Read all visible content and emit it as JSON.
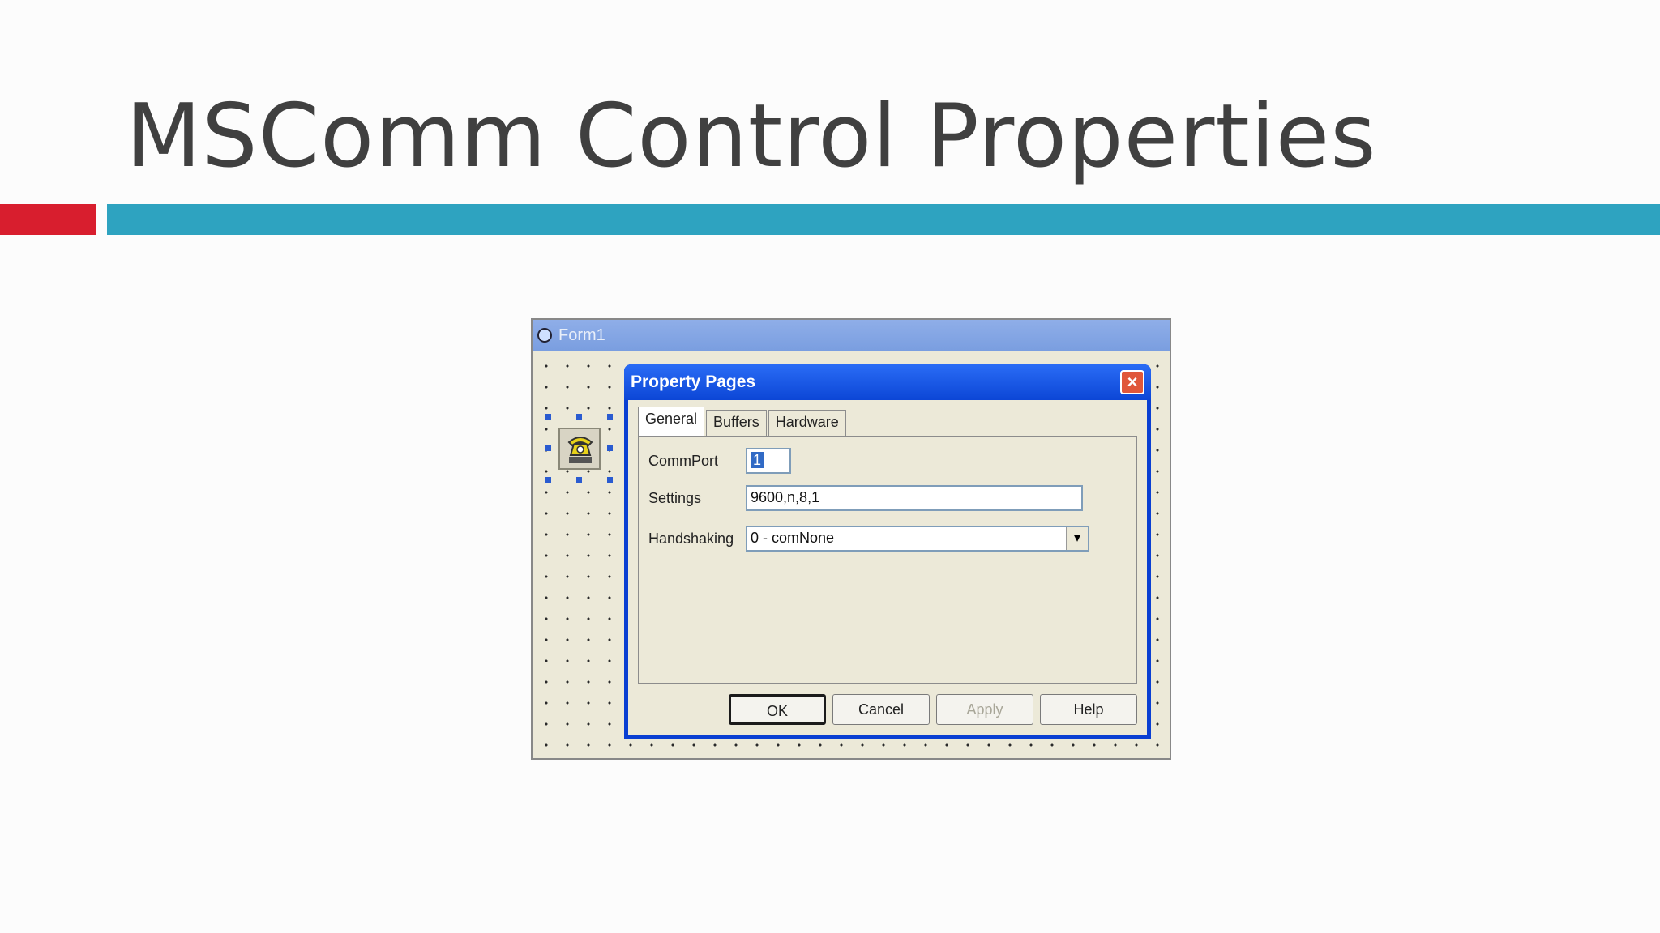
{
  "slide": {
    "title": "MSComm Control Properties"
  },
  "form1": {
    "title": "Form1",
    "icon": "form-icon",
    "control_icon": "telephone-icon"
  },
  "dialog": {
    "title": "Property Pages",
    "close_icon": "close-icon",
    "tabs": [
      {
        "label": "General",
        "active": true
      },
      {
        "label": "Buffers",
        "active": false
      },
      {
        "label": "Hardware",
        "active": false
      }
    ],
    "fields": {
      "commport_label": "CommPort",
      "commport_value": "1",
      "settings_label": "Settings",
      "settings_value": "9600,n,8,1",
      "handshaking_label": "Handshaking",
      "handshaking_value": "0 - comNone"
    },
    "buttons": {
      "ok": "OK",
      "cancel": "Cancel",
      "apply": "Apply",
      "help": "Help"
    }
  },
  "colors": {
    "accent_red": "#d81e2e",
    "accent_teal": "#2ea3c0",
    "dialog_blue": "#0a3fd2"
  }
}
